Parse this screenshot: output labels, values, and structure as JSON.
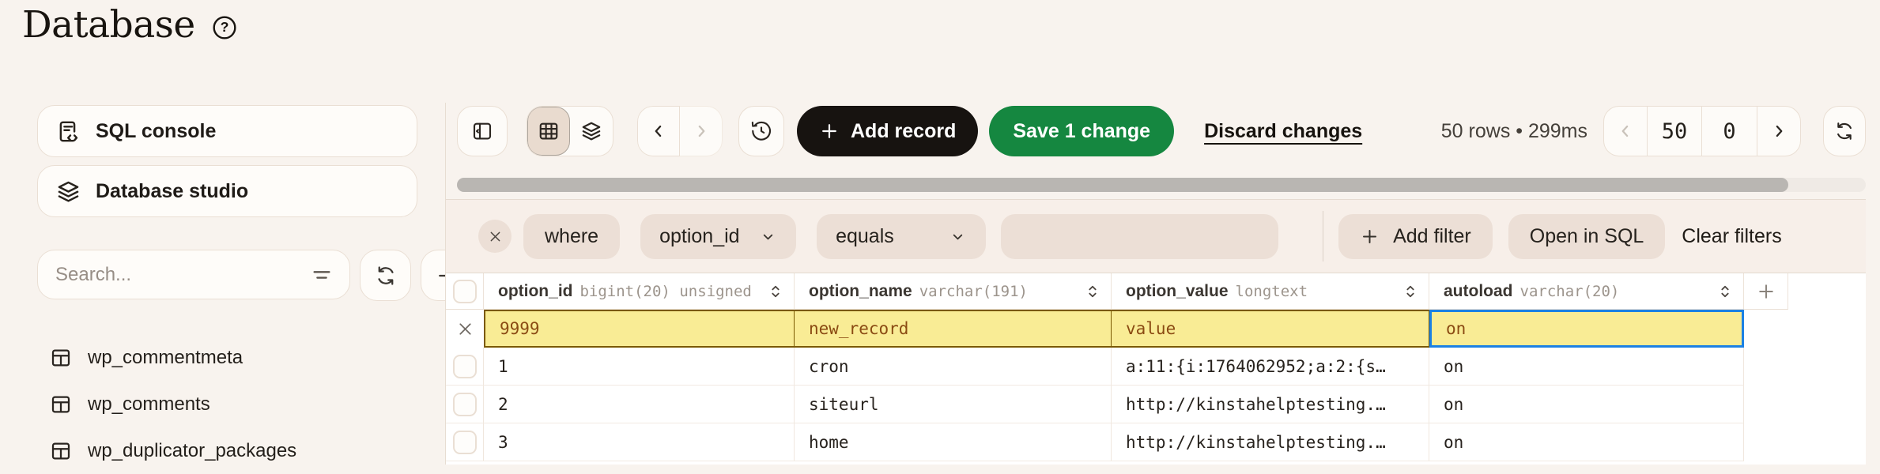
{
  "header": {
    "title": "Database"
  },
  "sidebar": {
    "nav": [
      {
        "label": "SQL console",
        "icon": "sql-console-icon"
      },
      {
        "label": "Database studio",
        "icon": "layers-icon"
      }
    ],
    "search": {
      "placeholder": "Search..."
    },
    "tables": [
      {
        "label": "wp_commentmeta"
      },
      {
        "label": "wp_comments"
      },
      {
        "label": "wp_duplicator_packages"
      }
    ]
  },
  "toolbar": {
    "add_record_label": "Add record",
    "save_label": "Save 1 change",
    "discard_label": "Discard changes",
    "stats": "50 rows • 299ms",
    "pagination": {
      "limit": "50",
      "offset": "0"
    }
  },
  "filter_bar": {
    "conjunction": "where",
    "column": "option_id",
    "operator": "equals",
    "value": "",
    "add_filter_label": "Add filter",
    "open_in_sql_label": "Open in SQL",
    "clear_filters_label": "Clear filters"
  },
  "table": {
    "columns": [
      {
        "name": "option_id",
        "type": "bigint(20) unsigned"
      },
      {
        "name": "option_name",
        "type": "varchar(191)"
      },
      {
        "name": "option_value",
        "type": "longtext"
      },
      {
        "name": "autoload",
        "type": "varchar(20)"
      }
    ],
    "rows": [
      {
        "state": "new",
        "cells": [
          "9999",
          "new_record",
          "value",
          "on"
        ]
      },
      {
        "state": "saved",
        "cells": [
          "1",
          "cron",
          "a:11:{i:1764062952;a:2:{s…",
          "on"
        ]
      },
      {
        "state": "saved",
        "cells": [
          "2",
          "siteurl",
          "http://kinstahelptesting.…",
          "on"
        ]
      },
      {
        "state": "saved",
        "cells": [
          "3",
          "home",
          "http://kinstahelptesting.…",
          "on"
        ]
      }
    ]
  },
  "colors": {
    "page_bg": "#F8F3EE",
    "border": "#EADFD4",
    "filter_bar_bg": "#F7EFE9",
    "pill_bg": "#ECDFD6",
    "button_dark": "#171310",
    "button_green": "#158740",
    "new_row_bg": "#F9EC95",
    "new_row_border": "#7A5901",
    "new_row_text": "#8A4A12",
    "selected_cell_border": "#1B81E4"
  }
}
